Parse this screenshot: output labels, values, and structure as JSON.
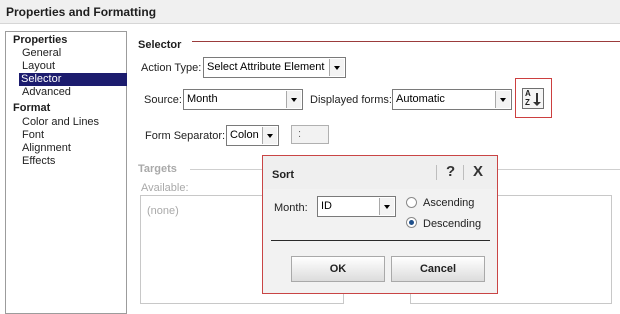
{
  "window": {
    "title": "Properties and Formatting"
  },
  "nav": {
    "groups": [
      {
        "label": "Properties",
        "items": [
          "General",
          "Layout",
          "Selector",
          "Advanced"
        ]
      },
      {
        "label": "Format",
        "items": [
          "Color and Lines",
          "Font",
          "Alignment",
          "Effects"
        ]
      }
    ],
    "selected": "Selector"
  },
  "selector": {
    "section_title": "Selector",
    "action_type_label": "Action Type:",
    "action_type_value": "Select Attribute Element",
    "source_label": "Source:",
    "source_value": "Month",
    "displayed_forms_label": "Displayed forms:",
    "displayed_forms_value": "Automatic",
    "sort_button_glyph": {
      "top": "A",
      "bottom": "Z"
    },
    "form_separator_label": "Form Separator:",
    "form_separator_value": "Colon",
    "separator_preview": ":"
  },
  "targets": {
    "section_title": "Targets",
    "available_label": "Available:",
    "available_items": [
      "(none)"
    ]
  },
  "sort_dialog": {
    "title": "Sort",
    "help_glyph": "?",
    "close_glyph": "X",
    "month_label": "Month:",
    "month_value": "ID",
    "ascending_label": "Ascending",
    "descending_label": "Descending",
    "selected_order": "Descending",
    "ok_label": "OK",
    "cancel_label": "Cancel"
  },
  "colors": {
    "selection": "#1c1c6e",
    "highlight_border": "#cc3f3f"
  }
}
